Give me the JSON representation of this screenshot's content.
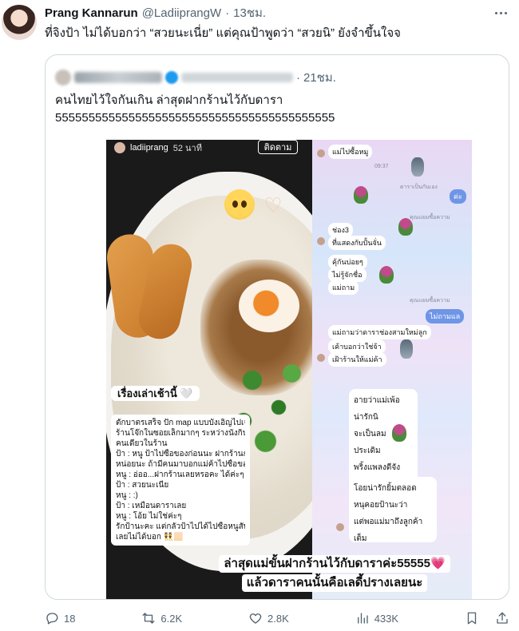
{
  "tweet": {
    "display_name": "Prang Kannarun",
    "handle": "@LadiiprangW",
    "separator": "·",
    "time": "13ชม.",
    "text": "ที่จิงป้า ไม่ได้บอกว่า “สวยนะเนี่ย” แต่คุณป้าพูดว่า “สวยนิ” ยังจำขึ้นใจจ"
  },
  "quote": {
    "separator": "·",
    "time": "21ชม.",
    "text_line1": "คนไทยไว้ใจกันเกิน ล่าสุดฝากร้านไว้กับดารา",
    "text_line2": "555555555555555555555555555555555555555555"
  },
  "story": {
    "username": "ladiiprang",
    "sub_time": "52 นาที",
    "follow_label": "ติดตาม",
    "title": "เรื่องเล่าเช้านี้ 🤍",
    "body_lines": [
      "ตักบาตรเสร็จ ปัก map แบบบังเอิญไปเจอ",
      "ร้านโจ๊กในซอยเล็กมากๆ ระหว่างนั่งกินอยู่",
      "คนเดียวในร้าน",
      "ป้า : หนู ป้าไปซื้อของก่อนนะ ฝากร้านกับหนู",
      "หน่อยนะ ถ้ามีคนมาบอกแม่ค้าไปซื้อของ",
      "หนู : อ่ออ...ฝากร้านเลยหรอคะ ได้ค่ะๆ",
      "ป้า : สวยนะเนี่ย",
      "หนู : :)",
      "ป้า : เหมือนดาราเลย",
      "หนู : โอ้ย ไม่ใช่ค่ะๆ",
      "รักป้านะคะ แต่กลัวป้าไปได้ไปซื้อหนูสับ",
      "เลยไม่ได้บอก 👯🏻"
    ],
    "caption_line1": "ล่าสุดแม่ขั้นฝากร้านไว้กับดาราค่ะ55555",
    "caption_heart": "💗",
    "caption_line2": "แล้วดาราคนนั้นคือเลดี้ปรางเลยนะ",
    "chat": {
      "msg1": "แม่ไปซื้อหมู",
      "time1": "09:37",
      "notice1": "ดาราเป็นกันเอง",
      "reply1": "ค่ะ",
      "label1": "คุณแยมซื้อความ",
      "msg2": "ช่อง3",
      "msg3": "ที่แสดงกับปั้นจั่น",
      "msg4": "คุ้กันบ่อยๆ",
      "msg5": "ไม่รู้จักชื่อ",
      "msg6": "แม่ถาม",
      "label2": "คุณแยมซื้อความ",
      "reply2": "ไม่ถามแล",
      "msg7": "แม่ถามว่าดาราช่องสามใหม่ลูก",
      "msg8": "เค้าบอกว่าใช่จ้า",
      "msg9": "เฝ้าร้านให้แม่ค้า",
      "card_lines": [
        "อายว่าแม่เพ้อ",
        "น่ารักนิ",
        "จะเป็นลม",
        "ประเดิม",
        "พริ้งแพลงดีจัง"
      ],
      "last_lines": [
        "โอยน่ารักยิ้มตลอด",
        "หนุคอยป้านะว่า",
        "แต่พอแม่มาถึงลูกค้าเต็ม"
      ]
    }
  },
  "actions": {
    "replies": "18",
    "reposts": "6.2K",
    "likes": "2.8K",
    "views": "433K"
  },
  "icons": [
    "more-icon",
    "reply-icon",
    "repost-icon",
    "like-icon",
    "views-icon",
    "bookmark-icon",
    "share-icon"
  ]
}
